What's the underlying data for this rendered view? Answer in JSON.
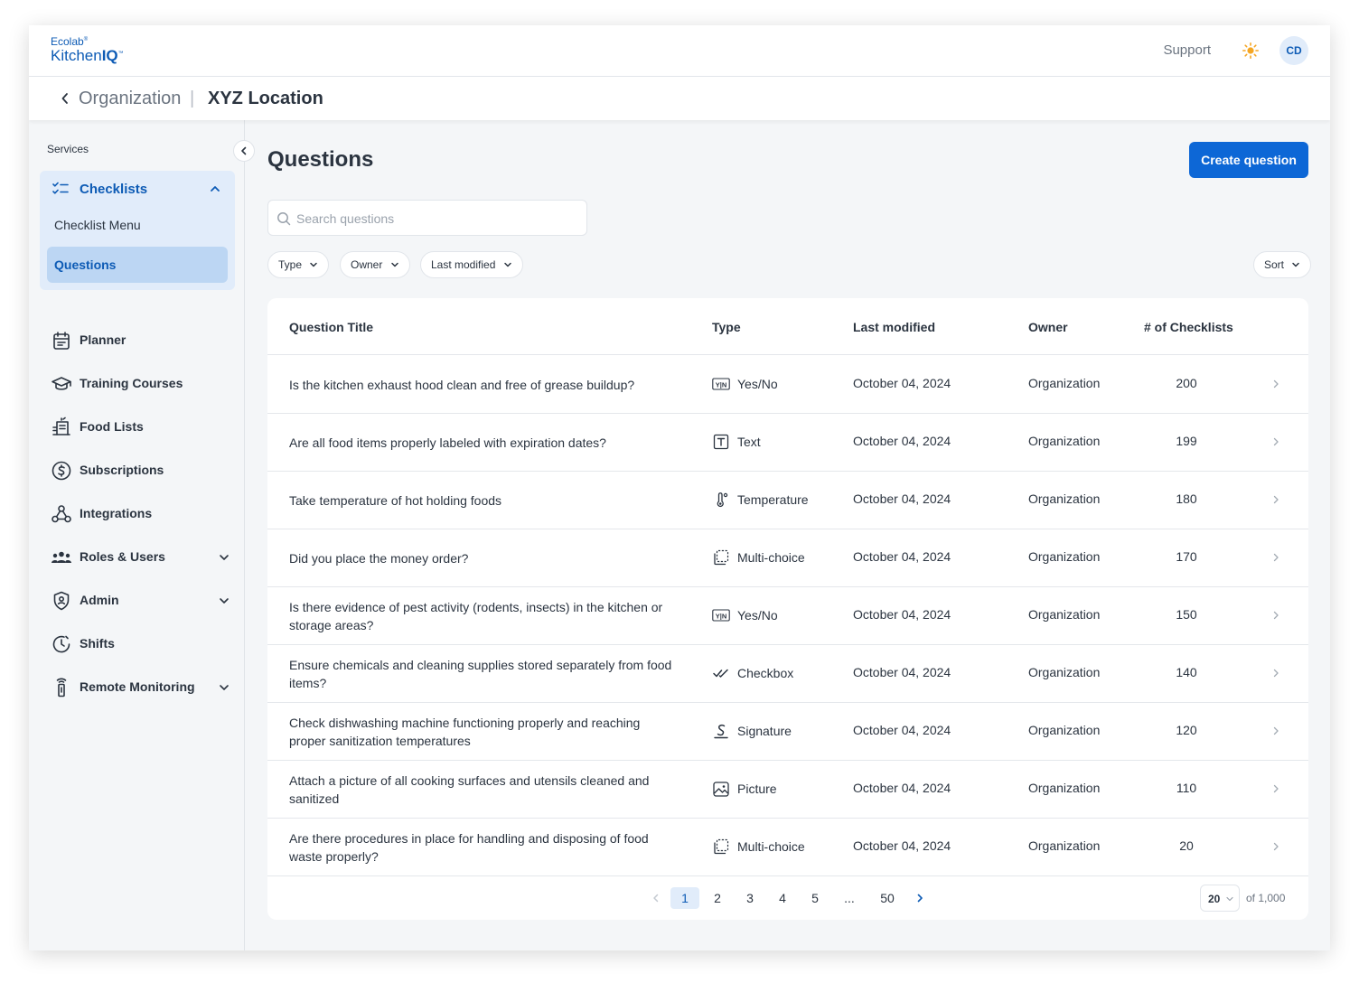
{
  "app": {
    "logo_top": "Ecolab",
    "logo_main": "Kitchen",
    "logo_bold": "IQ",
    "logo_mark": "®",
    "logo_tm": "™"
  },
  "header": {
    "support_label": "Support",
    "avatar_initials": "CD"
  },
  "breadcrumb": {
    "parent": "Organization",
    "separator": "|",
    "current": "XYZ Location"
  },
  "sidebar": {
    "section_label": "Services",
    "expanded_group": {
      "label": "Checklists",
      "icon": "checklist-icon",
      "children": [
        {
          "label": "Checklist Menu",
          "active": false
        },
        {
          "label": "Questions",
          "active": true
        }
      ]
    },
    "items": [
      {
        "label": "Planner",
        "icon": "calendar-icon",
        "has_submenu": false
      },
      {
        "label": "Training Courses",
        "icon": "graduation-cap-icon",
        "has_submenu": false
      },
      {
        "label": "Food Lists",
        "icon": "food-list-icon",
        "has_submenu": false
      },
      {
        "label": "Subscriptions",
        "icon": "dollar-circle-icon",
        "has_submenu": false
      },
      {
        "label": "Integrations",
        "icon": "webhook-icon",
        "has_submenu": false
      },
      {
        "label": "Roles & Users",
        "icon": "users-icon",
        "has_submenu": true
      },
      {
        "label": "Admin",
        "icon": "shield-icon",
        "has_submenu": true
      },
      {
        "label": "Shifts",
        "icon": "clock-icon",
        "has_submenu": false
      },
      {
        "label": "Remote Monitoring",
        "icon": "sensor-icon",
        "has_submenu": true
      }
    ]
  },
  "main": {
    "title": "Questions",
    "create_button": "Create question",
    "search_placeholder": "Search questions",
    "filters": {
      "type": "Type",
      "owner": "Owner",
      "last_modified": "Last modified",
      "sort": "Sort"
    }
  },
  "table": {
    "columns": {
      "title": "Question Title",
      "type": "Type",
      "modified": "Last modified",
      "owner": "Owner",
      "count": "# of Checklists"
    },
    "rows": [
      {
        "title": "Is the kitchen exhaust hood clean and free of grease buildup?",
        "type": "Yes/No",
        "type_icon": "yes-no-icon",
        "modified": "October 04, 2024",
        "owner": "Organization",
        "count": "200"
      },
      {
        "title": "Are all food items properly labeled with expiration dates?",
        "type": "Text",
        "type_icon": "text-icon",
        "modified": "October 04, 2024",
        "owner": "Organization",
        "count": "199"
      },
      {
        "title": "Take temperature of hot holding foods",
        "type": "Temperature",
        "type_icon": "thermometer-icon",
        "modified": "October 04, 2024",
        "owner": "Organization",
        "count": "180"
      },
      {
        "title": "Did you place the money order?",
        "type": "Multi-choice",
        "type_icon": "multi-choice-icon",
        "modified": "October 04, 2024",
        "owner": "Organization",
        "count": "170"
      },
      {
        "title": "Is there evidence of pest activity (rodents, insects) in the kitchen or storage areas?",
        "type": "Yes/No",
        "type_icon": "yes-no-icon",
        "modified": "October 04, 2024",
        "owner": "Organization",
        "count": "150"
      },
      {
        "title": "Ensure chemicals and cleaning supplies stored separately from food items?",
        "type": "Checkbox",
        "type_icon": "checkbox-icon",
        "modified": "October 04, 2024",
        "owner": "Organization",
        "count": "140"
      },
      {
        "title": "Check dishwashing machine functioning properly and reaching proper sanitization temperatures",
        "type": "Signature",
        "type_icon": "signature-icon",
        "modified": "October 04, 2024",
        "owner": "Organization",
        "count": "120"
      },
      {
        "title": "Attach a picture of all cooking surfaces and utensils cleaned and sanitized",
        "type": "Picture",
        "type_icon": "picture-icon",
        "modified": "October 04, 2024",
        "owner": "Organization",
        "count": "110"
      },
      {
        "title": "Are there procedures in place for handling and disposing of food waste properly?",
        "type": "Multi-choice",
        "type_icon": "multi-choice-icon",
        "modified": "October 04, 2024",
        "owner": "Organization",
        "count": "20"
      }
    ]
  },
  "pagination": {
    "pages": [
      "1",
      "2",
      "3",
      "4",
      "5",
      "...",
      "50"
    ],
    "current": "1",
    "per_page": "20",
    "total": "of 1,000"
  },
  "colors": {
    "brand": "#0d5bb5",
    "button": "#0d67d6",
    "active_bg": "#bcd6f3",
    "group_bg": "#e1ecfa",
    "sun": "#f5a623"
  }
}
